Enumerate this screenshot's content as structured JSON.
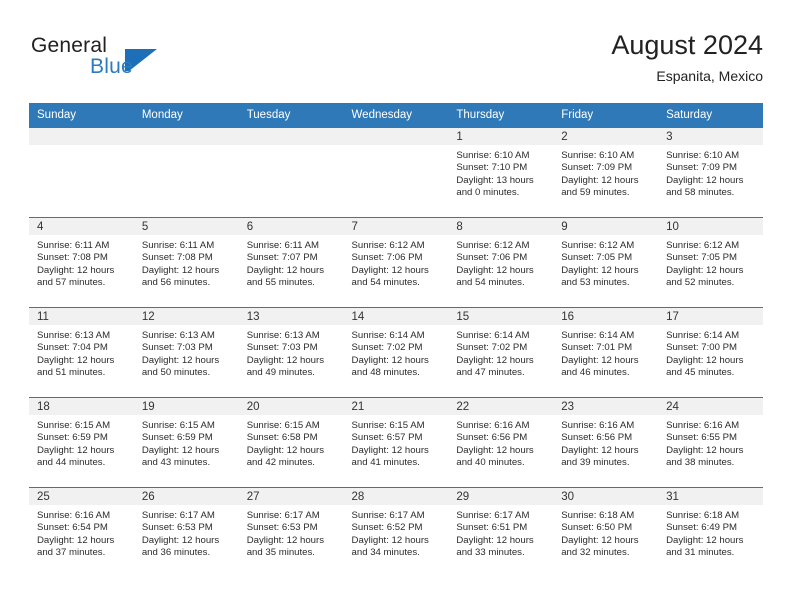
{
  "brand": {
    "word1": "General",
    "word2": "Blue",
    "flag_color": "#1d6fb8"
  },
  "header": {
    "title": "August 2024",
    "location": "Espanita, Mexico"
  },
  "theme": {
    "header_bg": "#3079b8",
    "day_band_bg": "#f1f1f1",
    "rule_color": "#3079b8"
  },
  "weekday_headers": [
    "Sunday",
    "Monday",
    "Tuesday",
    "Wednesday",
    "Thursday",
    "Friday",
    "Saturday"
  ],
  "weeks": [
    [
      {
        "day": "",
        "empty": true
      },
      {
        "day": "",
        "empty": true
      },
      {
        "day": "",
        "empty": true
      },
      {
        "day": "",
        "empty": true
      },
      {
        "day": "1",
        "sunrise": "Sunrise: 6:10 AM",
        "sunset": "Sunset: 7:10 PM",
        "daylight_line1": "Daylight: 13 hours",
        "daylight_line2": "and 0 minutes."
      },
      {
        "day": "2",
        "sunrise": "Sunrise: 6:10 AM",
        "sunset": "Sunset: 7:09 PM",
        "daylight_line1": "Daylight: 12 hours",
        "daylight_line2": "and 59 minutes."
      },
      {
        "day": "3",
        "sunrise": "Sunrise: 6:10 AM",
        "sunset": "Sunset: 7:09 PM",
        "daylight_line1": "Daylight: 12 hours",
        "daylight_line2": "and 58 minutes."
      }
    ],
    [
      {
        "day": "4",
        "sunrise": "Sunrise: 6:11 AM",
        "sunset": "Sunset: 7:08 PM",
        "daylight_line1": "Daylight: 12 hours",
        "daylight_line2": "and 57 minutes."
      },
      {
        "day": "5",
        "sunrise": "Sunrise: 6:11 AM",
        "sunset": "Sunset: 7:08 PM",
        "daylight_line1": "Daylight: 12 hours",
        "daylight_line2": "and 56 minutes."
      },
      {
        "day": "6",
        "sunrise": "Sunrise: 6:11 AM",
        "sunset": "Sunset: 7:07 PM",
        "daylight_line1": "Daylight: 12 hours",
        "daylight_line2": "and 55 minutes."
      },
      {
        "day": "7",
        "sunrise": "Sunrise: 6:12 AM",
        "sunset": "Sunset: 7:06 PM",
        "daylight_line1": "Daylight: 12 hours",
        "daylight_line2": "and 54 minutes."
      },
      {
        "day": "8",
        "sunrise": "Sunrise: 6:12 AM",
        "sunset": "Sunset: 7:06 PM",
        "daylight_line1": "Daylight: 12 hours",
        "daylight_line2": "and 54 minutes."
      },
      {
        "day": "9",
        "sunrise": "Sunrise: 6:12 AM",
        "sunset": "Sunset: 7:05 PM",
        "daylight_line1": "Daylight: 12 hours",
        "daylight_line2": "and 53 minutes."
      },
      {
        "day": "10",
        "sunrise": "Sunrise: 6:12 AM",
        "sunset": "Sunset: 7:05 PM",
        "daylight_line1": "Daylight: 12 hours",
        "daylight_line2": "and 52 minutes."
      }
    ],
    [
      {
        "day": "11",
        "sunrise": "Sunrise: 6:13 AM",
        "sunset": "Sunset: 7:04 PM",
        "daylight_line1": "Daylight: 12 hours",
        "daylight_line2": "and 51 minutes."
      },
      {
        "day": "12",
        "sunrise": "Sunrise: 6:13 AM",
        "sunset": "Sunset: 7:03 PM",
        "daylight_line1": "Daylight: 12 hours",
        "daylight_line2": "and 50 minutes."
      },
      {
        "day": "13",
        "sunrise": "Sunrise: 6:13 AM",
        "sunset": "Sunset: 7:03 PM",
        "daylight_line1": "Daylight: 12 hours",
        "daylight_line2": "and 49 minutes."
      },
      {
        "day": "14",
        "sunrise": "Sunrise: 6:14 AM",
        "sunset": "Sunset: 7:02 PM",
        "daylight_line1": "Daylight: 12 hours",
        "daylight_line2": "and 48 minutes."
      },
      {
        "day": "15",
        "sunrise": "Sunrise: 6:14 AM",
        "sunset": "Sunset: 7:02 PM",
        "daylight_line1": "Daylight: 12 hours",
        "daylight_line2": "and 47 minutes."
      },
      {
        "day": "16",
        "sunrise": "Sunrise: 6:14 AM",
        "sunset": "Sunset: 7:01 PM",
        "daylight_line1": "Daylight: 12 hours",
        "daylight_line2": "and 46 minutes."
      },
      {
        "day": "17",
        "sunrise": "Sunrise: 6:14 AM",
        "sunset": "Sunset: 7:00 PM",
        "daylight_line1": "Daylight: 12 hours",
        "daylight_line2": "and 45 minutes."
      }
    ],
    [
      {
        "day": "18",
        "sunrise": "Sunrise: 6:15 AM",
        "sunset": "Sunset: 6:59 PM",
        "daylight_line1": "Daylight: 12 hours",
        "daylight_line2": "and 44 minutes."
      },
      {
        "day": "19",
        "sunrise": "Sunrise: 6:15 AM",
        "sunset": "Sunset: 6:59 PM",
        "daylight_line1": "Daylight: 12 hours",
        "daylight_line2": "and 43 minutes."
      },
      {
        "day": "20",
        "sunrise": "Sunrise: 6:15 AM",
        "sunset": "Sunset: 6:58 PM",
        "daylight_line1": "Daylight: 12 hours",
        "daylight_line2": "and 42 minutes."
      },
      {
        "day": "21",
        "sunrise": "Sunrise: 6:15 AM",
        "sunset": "Sunset: 6:57 PM",
        "daylight_line1": "Daylight: 12 hours",
        "daylight_line2": "and 41 minutes."
      },
      {
        "day": "22",
        "sunrise": "Sunrise: 6:16 AM",
        "sunset": "Sunset: 6:56 PM",
        "daylight_line1": "Daylight: 12 hours",
        "daylight_line2": "and 40 minutes."
      },
      {
        "day": "23",
        "sunrise": "Sunrise: 6:16 AM",
        "sunset": "Sunset: 6:56 PM",
        "daylight_line1": "Daylight: 12 hours",
        "daylight_line2": "and 39 minutes."
      },
      {
        "day": "24",
        "sunrise": "Sunrise: 6:16 AM",
        "sunset": "Sunset: 6:55 PM",
        "daylight_line1": "Daylight: 12 hours",
        "daylight_line2": "and 38 minutes."
      }
    ],
    [
      {
        "day": "25",
        "sunrise": "Sunrise: 6:16 AM",
        "sunset": "Sunset: 6:54 PM",
        "daylight_line1": "Daylight: 12 hours",
        "daylight_line2": "and 37 minutes."
      },
      {
        "day": "26",
        "sunrise": "Sunrise: 6:17 AM",
        "sunset": "Sunset: 6:53 PM",
        "daylight_line1": "Daylight: 12 hours",
        "daylight_line2": "and 36 minutes."
      },
      {
        "day": "27",
        "sunrise": "Sunrise: 6:17 AM",
        "sunset": "Sunset: 6:53 PM",
        "daylight_line1": "Daylight: 12 hours",
        "daylight_line2": "and 35 minutes."
      },
      {
        "day": "28",
        "sunrise": "Sunrise: 6:17 AM",
        "sunset": "Sunset: 6:52 PM",
        "daylight_line1": "Daylight: 12 hours",
        "daylight_line2": "and 34 minutes."
      },
      {
        "day": "29",
        "sunrise": "Sunrise: 6:17 AM",
        "sunset": "Sunset: 6:51 PM",
        "daylight_line1": "Daylight: 12 hours",
        "daylight_line2": "and 33 minutes."
      },
      {
        "day": "30",
        "sunrise": "Sunrise: 6:18 AM",
        "sunset": "Sunset: 6:50 PM",
        "daylight_line1": "Daylight: 12 hours",
        "daylight_line2": "and 32 minutes."
      },
      {
        "day": "31",
        "sunrise": "Sunrise: 6:18 AM",
        "sunset": "Sunset: 6:49 PM",
        "daylight_line1": "Daylight: 12 hours",
        "daylight_line2": "and 31 minutes."
      }
    ]
  ]
}
